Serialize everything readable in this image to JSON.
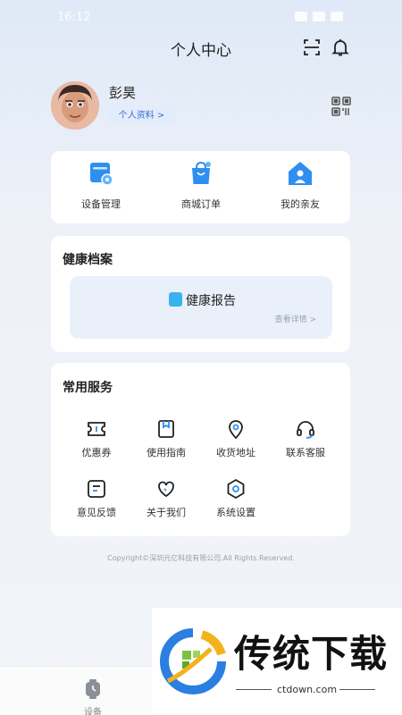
{
  "status_bar": {
    "time": "16:12"
  },
  "header": {
    "title": "个人中心"
  },
  "profile": {
    "name": "彭昊",
    "profile_link": "个人资料 >"
  },
  "quick_actions": [
    {
      "label": "设备管理",
      "icon": "device-manage-icon"
    },
    {
      "label": "商城订单",
      "icon": "shopping-bag-icon"
    },
    {
      "label": "我的亲友",
      "icon": "family-house-icon"
    }
  ],
  "health": {
    "section_title": "健康档案",
    "report_title": "健康报告",
    "report_link": "查看详情 >"
  },
  "services": {
    "section_title": "常用服务",
    "items": [
      {
        "label": "优惠券",
        "icon": "coupon-icon"
      },
      {
        "label": "使用指南",
        "icon": "guide-book-icon"
      },
      {
        "label": "收货地址",
        "icon": "location-pin-icon"
      },
      {
        "label": "联系客服",
        "icon": "headset-icon"
      },
      {
        "label": "意见反馈",
        "icon": "feedback-icon"
      },
      {
        "label": "关于我们",
        "icon": "heart-icon"
      },
      {
        "label": "系统设置",
        "icon": "settings-hex-icon"
      }
    ]
  },
  "footer": {
    "copyright": "Copyright©深圳元亿科技有限公司.All Rights Reserved."
  },
  "tabbar": {
    "device_label": "设备"
  },
  "watermark": {
    "brand": "传统下载",
    "url": "ctdown.com"
  },
  "colors": {
    "accent": "#3a6fd8",
    "icon_blue": "#2f8ff0",
    "card_bg": "#ffffff"
  }
}
